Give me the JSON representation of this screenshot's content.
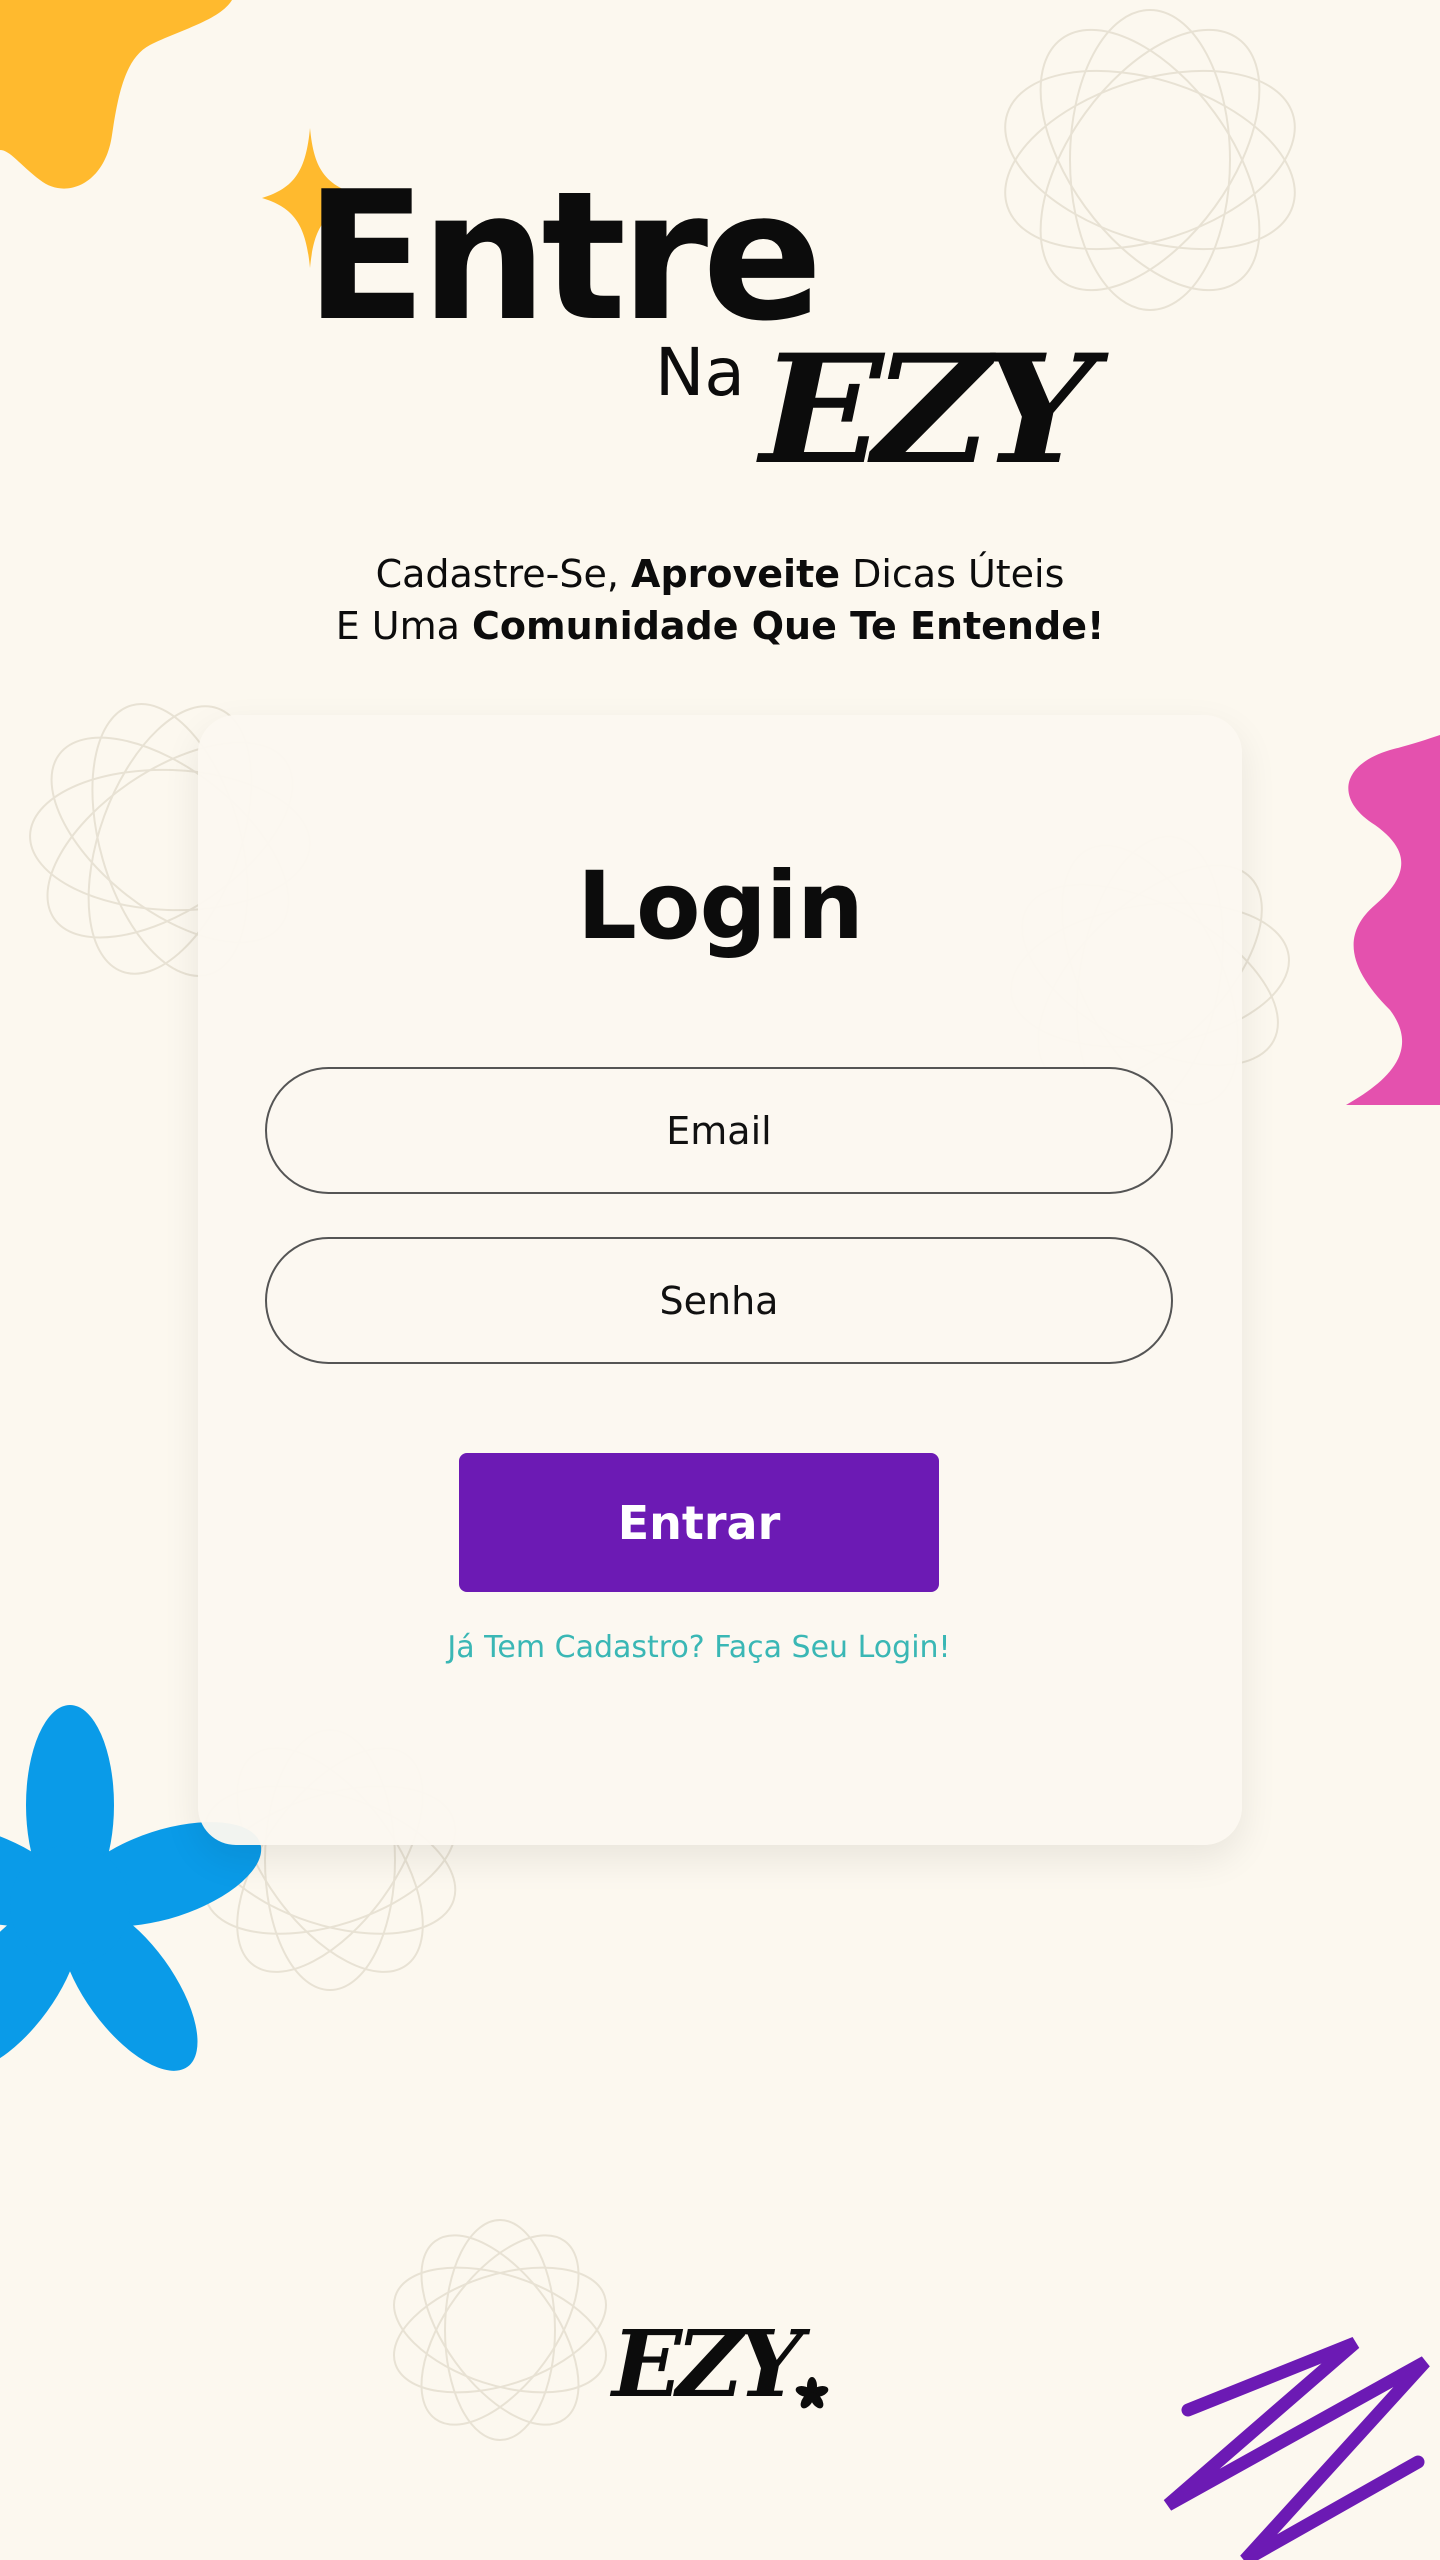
{
  "header": {
    "title_line1": "Entre",
    "title_line2_prefix": "Na",
    "brand": "EZY"
  },
  "subtitle": {
    "line1_regular1": "Cadastre-Se, ",
    "line1_bold": "Aproveite",
    "line1_regular2": " Dicas Úteis",
    "line2_regular": "E Uma ",
    "line2_bold": "Comunidade Que Te Entende!"
  },
  "login": {
    "title": "Login",
    "email_placeholder": "Email",
    "password_placeholder": "Senha",
    "submit_label": "Entrar",
    "link_text": "Já Tem Cadastro? Faça Seu Login!"
  },
  "footer": {
    "brand": "EZY"
  },
  "colors": {
    "background": "#fcf8ef",
    "accent_purple": "#6c1ab4",
    "accent_yellow": "#ffba2e",
    "accent_pink": "#e451ae",
    "accent_blue": "#0a9be8",
    "link_teal": "#3ab7b5"
  },
  "icons": [
    "sparkle-icon",
    "asterisk-icon"
  ]
}
